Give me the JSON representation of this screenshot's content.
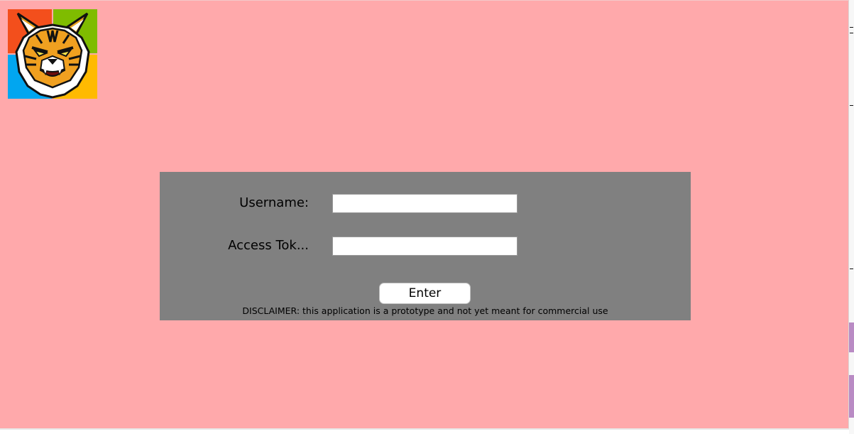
{
  "logo": {
    "icon": "bobcat-mascot-icon",
    "tile_colors": {
      "top_left": "#f34f1c",
      "top_right": "#7fbc00",
      "bottom_left": "#01a6f0",
      "bottom_right": "#ffba01"
    }
  },
  "theme": {
    "background": "#ffa9ab",
    "panel": "#808080"
  },
  "login": {
    "username_label": "Username:",
    "username_value": "",
    "token_label": "Access Tok...",
    "token_value": "",
    "enter_label": "Enter",
    "disclaimer": "DISCLAIMER: this application is a prototype and not yet meant for commercial use"
  }
}
